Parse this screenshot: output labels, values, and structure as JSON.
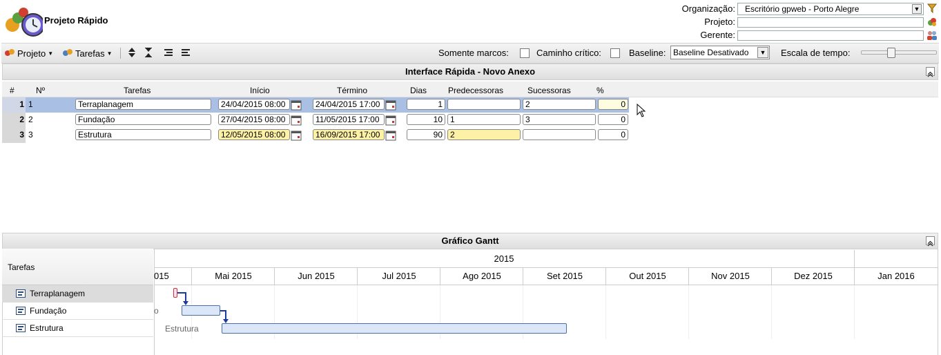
{
  "app": {
    "title": "Projeto Rápido"
  },
  "header": {
    "org_label": "Organização:",
    "org_value": "Escritório gpweb - Porto Alegre",
    "project_label": "Projeto:",
    "project_value": "",
    "manager_label": "Gerente:",
    "manager_value": ""
  },
  "toolbar": {
    "projeto_label": "Projeto",
    "tarefas_label": "Tarefas",
    "milestones_label": "Somente marcos:",
    "critical_label": "Caminho crítico:",
    "baseline_label": "Baseline:",
    "baseline_value": "Baseline Desativado",
    "timescale_label": "Escala de tempo:",
    "timescale_level": 0.38
  },
  "quick": {
    "title": "Interface Rápida - Novo Anexo",
    "columns": [
      "#",
      "Nº",
      "Tarefas",
      "Início",
      "Término",
      "Dias",
      "Predecessoras",
      "Sucessoras",
      "%"
    ],
    "rows": [
      {
        "num": "1",
        "no": "1",
        "task": "Terraplanagem",
        "start": "24/04/2015 08:00",
        "end": "24/04/2015 17:00",
        "days": "1",
        "pred": "",
        "succ": "2",
        "pct": "0"
      },
      {
        "num": "2",
        "no": "2",
        "task": "Fundação",
        "start": "27/04/2015 08:00",
        "end": "11/05/2015 17:00",
        "days": "10",
        "pred": "1",
        "succ": "3",
        "pct": "0"
      },
      {
        "num": "3",
        "no": "3",
        "task": "Estrutura",
        "start": "12/05/2015 08:00",
        "end": "16/09/2015 17:00",
        "days": "90",
        "pred": "2",
        "succ": "",
        "pct": "0"
      }
    ]
  },
  "gantt": {
    "title": "Gráfico Gantt",
    "left_header": "Tarefas",
    "year": "2015",
    "months": [
      "015",
      "Mai 2015",
      "Jun 2015",
      "Jul 2015",
      "Ago 2015",
      "Set 2015",
      "Out 2015",
      "Nov 2015",
      "Dez 2015",
      "Jan 2016"
    ],
    "tasks": [
      "Terraplanagem",
      "Fundação",
      "Estrutura"
    ],
    "bar_labels": [
      "o",
      "Estrutura"
    ]
  }
}
